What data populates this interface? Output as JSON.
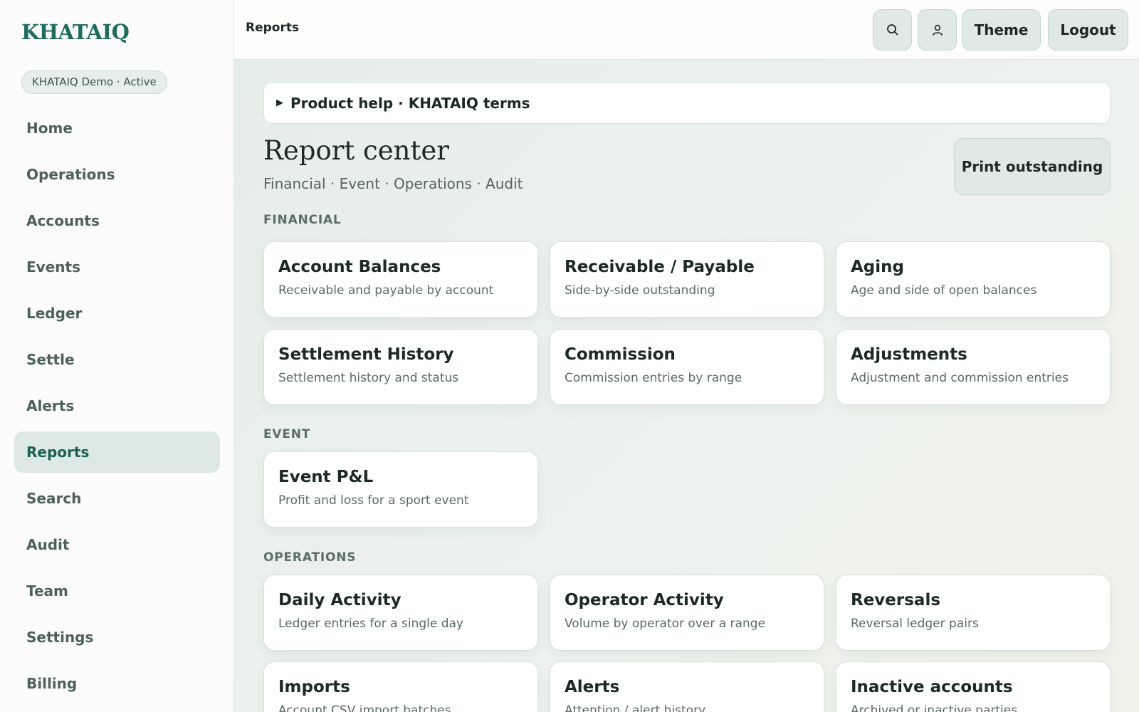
{
  "sidebar": {
    "brand": "KHATAIQ",
    "org_badge": "KHATAIQ Demo · Active",
    "items": [
      {
        "label": "Home"
      },
      {
        "label": "Operations"
      },
      {
        "label": "Accounts"
      },
      {
        "label": "Events"
      },
      {
        "label": "Ledger"
      },
      {
        "label": "Settle"
      },
      {
        "label": "Alerts"
      },
      {
        "label": "Reports",
        "active": true
      },
      {
        "label": "Search"
      },
      {
        "label": "Audit"
      },
      {
        "label": "Team"
      },
      {
        "label": "Settings"
      },
      {
        "label": "Billing"
      }
    ]
  },
  "topbar": {
    "breadcrumb": "Reports",
    "search_icon": "search-icon",
    "user_icon": "user-icon",
    "theme_label": "Theme",
    "logout_label": "Logout"
  },
  "help": {
    "label": "Product help · KHATAIQ terms",
    "icon": "disclosure-triangle-icon"
  },
  "page": {
    "title": "Report center",
    "subtitle": "Financial · Event · Operations · Audit",
    "print_label": "Print outstanding"
  },
  "sections": {
    "financial": {
      "label": "FINANCIAL",
      "cards": [
        {
          "title": "Account Balances",
          "desc": "Receivable and payable by account"
        },
        {
          "title": "Receivable / Payable",
          "desc": "Side-by-side outstanding"
        },
        {
          "title": "Aging",
          "desc": "Age and side of open balances"
        },
        {
          "title": "Settlement History",
          "desc": "Settlement history and status"
        },
        {
          "title": "Commission",
          "desc": "Commission entries by range"
        },
        {
          "title": "Adjustments",
          "desc": "Adjustment and commission entries"
        }
      ]
    },
    "event": {
      "label": "EVENT",
      "cards": [
        {
          "title": "Event P&L",
          "desc": "Profit and loss for a sport event"
        }
      ]
    },
    "operations": {
      "label": "OPERATIONS",
      "cards": [
        {
          "title": "Daily Activity",
          "desc": "Ledger entries for a single day"
        },
        {
          "title": "Operator Activity",
          "desc": "Volume by operator over a range"
        },
        {
          "title": "Reversals",
          "desc": "Reversal ledger pairs"
        },
        {
          "title": "Imports",
          "desc": "Account CSV import batches"
        },
        {
          "title": "Alerts",
          "desc": "Attention / alert history"
        },
        {
          "title": "Inactive accounts",
          "desc": "Archived or inactive parties"
        }
      ]
    }
  },
  "colors": {
    "brand": "#1f6b5c",
    "active_nav_bg": "#dde9e5",
    "button_bg": "#dfe9e5"
  }
}
